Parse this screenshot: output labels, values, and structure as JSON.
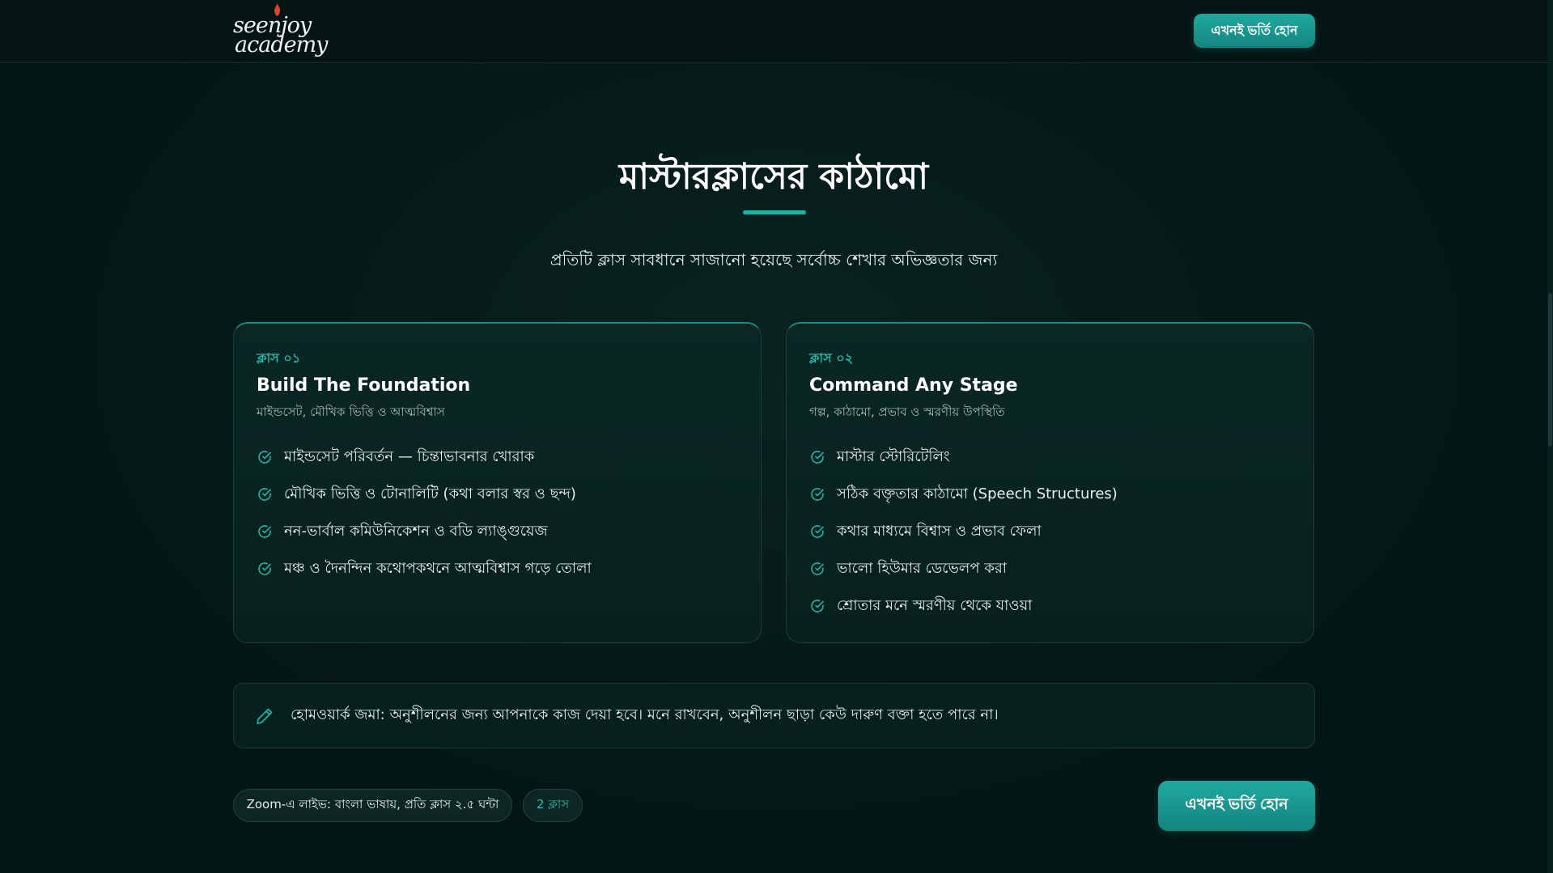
{
  "header": {
    "logo_line1": "seenjoy",
    "logo_line2": "academy",
    "cta_label": "এখনই ভর্তি হোন"
  },
  "section": {
    "title": "মাস্টারক্লাসের কাঠামো",
    "subtitle": "প্রতিটি ক্লাস সাবধানে সাজানো হয়েছে সর্বোচ্চ শেখার অভিজ্ঞতার জন্য"
  },
  "cards": [
    {
      "tag": "ক্লাস ০১",
      "title": "Build The Foundation",
      "subtitle": "মাইন্ডসেট, মৌখিক ভিত্তি ও আত্মবিশ্বাস",
      "items": [
        "মাইন্ডসেট পরিবর্তন — চিন্তাভাবনার খোরাক",
        "মৌখিক ভিত্তি ও টোনালিটি (কথা বলার স্বর ও ছন্দ)",
        "নন-ভার্বাল কমিউনিকেশন ও বডি ল্যাঙ্গুয়েজ",
        "মঞ্চ ও দৈনন্দিন কথোপকথনে আত্মবিশ্বাস গড়ে তোলা"
      ]
    },
    {
      "tag": "ক্লাস ০২",
      "title": "Command Any Stage",
      "subtitle": "গল্প, কাঠামো, প্রভাব ও স্মরণীয় উপস্থিতি",
      "items": [
        "মাস্টার স্টোরিটেলিং",
        "সঠিক বক্তৃতার কাঠামো (Speech Structures)",
        "কথার মাধ্যমে বিশ্বাস ও প্রভাব ফেলা",
        "ভালো হিউমার ডেভেলপ করা",
        "শ্রোতার মনে স্মরণীয় থেকে যাওয়া"
      ]
    }
  ],
  "note": {
    "text": "হোমওয়ার্ক জমা: অনুশীলনের জন্য আপনাকে কাজ দেয়া হবে। মনে রাখবেন, অনুশীলন ছাড়া কেউ দারুণ বক্তা হতে পারে না।",
    "icon": "pencil-icon"
  },
  "footer": {
    "zoom_pill": "Zoom-এ লাইভ: বাংলা ভাষায়, প্রতি ক্লাস ২.৫ ঘন্টা",
    "count_pill": "2 ক্লাস",
    "cta_label": "এখনই ভর্তি হোন"
  },
  "colors": {
    "accent": "#1fa9a0",
    "background": "#041614",
    "card": "#0a2724"
  }
}
